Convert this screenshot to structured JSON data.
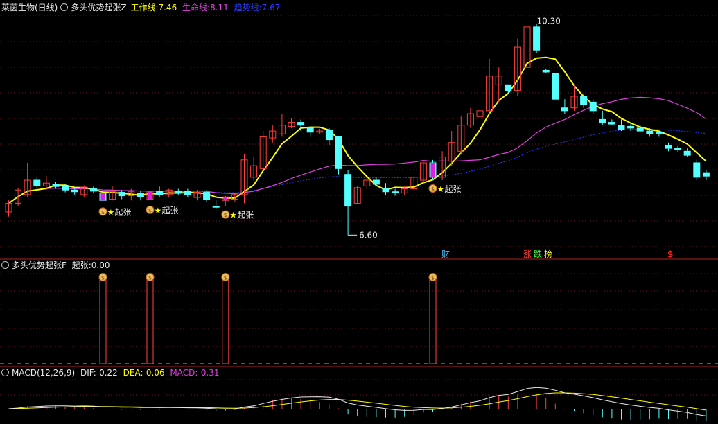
{
  "colors": {
    "background": "#000000",
    "up": "#ff4040",
    "down": "#54ffff",
    "work_line": "#ffff00",
    "life_line": "#e040e0",
    "trend_line": "#2a3cff",
    "grid": "#7a1010",
    "signal": "#ffff00",
    "white": "#e8e8e8"
  },
  "header_main": {
    "stock": "莱茵生物(日线)",
    "indicator": "多头优势起张Z",
    "work_label": "工作线:",
    "work_value": "7.46",
    "life_label": "生命线:",
    "life_value": "8.11",
    "trend_label": "趋势线:",
    "trend_value": "7.67"
  },
  "header_sub": {
    "indicator": "多头优势起张F",
    "signal_label": "起张:",
    "signal_value": "0.00"
  },
  "header_macd": {
    "indicator": "MACD(12,26,9)",
    "dif_label": "DIF:",
    "dif_value": "-0.22",
    "dea_label": "DEA:",
    "dea_value": "-0.06",
    "macd_label": "MACD:",
    "macd_value": "-0.31"
  },
  "annotations": {
    "high_label": "10.30",
    "low_label": "6.60",
    "signal_text": "起张",
    "signal_icon": "money-bag-icon",
    "event_cai": "财",
    "event_zhang": "涨",
    "event_die": "跌",
    "event_bang": "榜",
    "event_s": "$"
  },
  "chart_data": [
    {
      "type": "candlestick",
      "name": "main",
      "y_range": [
        6.4,
        10.45
      ],
      "candles": [
        [
          7.0,
          7.15,
          6.92,
          7.2
        ],
        [
          7.15,
          7.38,
          7.1,
          7.42
        ],
        [
          7.3,
          7.55,
          7.25,
          7.85
        ],
        [
          7.55,
          7.45,
          7.4,
          7.6
        ],
        [
          7.45,
          7.5,
          7.38,
          7.62
        ],
        [
          7.48,
          7.44,
          7.4,
          7.52
        ],
        [
          7.44,
          7.38,
          7.34,
          7.48
        ],
        [
          7.38,
          7.35,
          7.3,
          7.42
        ],
        [
          7.3,
          7.43,
          7.25,
          7.46
        ],
        [
          7.4,
          7.36,
          7.32,
          7.44
        ],
        [
          7.33,
          7.2,
          7.15,
          7.4
        ],
        [
          7.22,
          7.35,
          7.2,
          7.44
        ],
        [
          7.34,
          7.28,
          7.22,
          7.38
        ],
        [
          7.28,
          7.35,
          7.2,
          7.4
        ],
        [
          7.32,
          7.26,
          7.2,
          7.36
        ],
        [
          7.22,
          7.36,
          7.18,
          7.4
        ],
        [
          7.36,
          7.3,
          7.25,
          7.44
        ],
        [
          7.3,
          7.38,
          7.25,
          7.4
        ],
        [
          7.36,
          7.34,
          7.3,
          7.4
        ],
        [
          7.36,
          7.3,
          7.25,
          7.4
        ],
        [
          7.25,
          7.34,
          7.2,
          7.38
        ],
        [
          7.34,
          7.22,
          7.18,
          7.38
        ],
        [
          7.1,
          7.08,
          7.05,
          7.2
        ],
        [
          7.2,
          7.26,
          7.1,
          7.28
        ],
        [
          7.22,
          7.3,
          7.18,
          7.32
        ],
        [
          7.3,
          7.9,
          7.15,
          8.0
        ],
        [
          7.6,
          7.8,
          7.55,
          7.95
        ],
        [
          7.75,
          8.3,
          7.7,
          8.4
        ],
        [
          8.28,
          8.4,
          8.2,
          8.5
        ],
        [
          8.35,
          8.5,
          8.3,
          8.7
        ],
        [
          8.48,
          8.55,
          8.45,
          8.62
        ],
        [
          8.55,
          8.5,
          8.4,
          8.6
        ],
        [
          8.45,
          8.38,
          8.3,
          8.45
        ],
        [
          8.38,
          8.4,
          8.35,
          8.44
        ],
        [
          8.42,
          8.25,
          8.15,
          8.45
        ],
        [
          8.3,
          7.75,
          7.65,
          8.3
        ],
        [
          7.65,
          7.1,
          6.6,
          7.72
        ],
        [
          7.15,
          7.42,
          7.15,
          7.45
        ],
        [
          7.45,
          7.55,
          7.4,
          7.6
        ],
        [
          7.55,
          7.48,
          7.45,
          7.6
        ],
        [
          7.4,
          7.35,
          7.3,
          7.5
        ],
        [
          7.35,
          7.33,
          7.28,
          7.4
        ],
        [
          7.33,
          7.4,
          7.3,
          7.45
        ],
        [
          7.4,
          7.6,
          7.38,
          7.62
        ],
        [
          7.55,
          7.85,
          7.5,
          7.85
        ],
        [
          7.85,
          7.6,
          7.55,
          7.9
        ],
        [
          7.6,
          7.95,
          7.55,
          8.05
        ],
        [
          7.88,
          8.2,
          7.8,
          8.4
        ],
        [
          8.05,
          8.5,
          8.0,
          8.65
        ],
        [
          8.5,
          8.7,
          8.45,
          8.8
        ],
        [
          8.65,
          8.75,
          8.6,
          8.85
        ],
        [
          8.75,
          9.35,
          8.7,
          9.65
        ],
        [
          9.2,
          9.35,
          8.9,
          9.5
        ],
        [
          9.2,
          9.1,
          9.05,
          9.2
        ],
        [
          9.1,
          9.85,
          9.0,
          10.0
        ],
        [
          9.5,
          10.2,
          9.3,
          10.3
        ],
        [
          10.2,
          9.8,
          9.75,
          10.25
        ],
        [
          9.45,
          9.42,
          9.4,
          9.48
        ],
        [
          9.4,
          8.95,
          8.95,
          9.35
        ],
        [
          8.8,
          8.75,
          8.7,
          8.95
        ],
        [
          8.8,
          9.0,
          8.75,
          9.2
        ],
        [
          9.0,
          8.85,
          8.8,
          9.05
        ],
        [
          8.9,
          8.75,
          8.7,
          8.95
        ],
        [
          8.6,
          8.55,
          8.5,
          8.75
        ],
        [
          8.55,
          8.52,
          8.5,
          8.6
        ],
        [
          8.5,
          8.42,
          8.4,
          8.6
        ],
        [
          8.48,
          8.45,
          8.4,
          8.55
        ],
        [
          8.45,
          8.4,
          8.38,
          8.5
        ],
        [
          8.4,
          8.35,
          8.3,
          8.45
        ],
        [
          8.38,
          8.36,
          8.3,
          8.4
        ],
        [
          8.15,
          8.1,
          8.05,
          8.2
        ],
        [
          8.1,
          8.08,
          8.04,
          8.14
        ],
        [
          8.05,
          7.98,
          7.95,
          8.1
        ],
        [
          7.85,
          7.6,
          7.55,
          7.9
        ],
        [
          7.68,
          7.62,
          7.55,
          7.72
        ]
      ],
      "high": 10.3,
      "low": 6.6,
      "signal_indices": [
        10,
        15,
        23,
        45
      ]
    },
    {
      "type": "line",
      "name": "sub",
      "y_range": [
        0,
        1.2
      ],
      "signal_indices": [
        10,
        15,
        23,
        45
      ],
      "values_note_value": 1
    },
    {
      "type": "bar",
      "name": "macd",
      "y_range": [
        -0.55,
        0.55
      ]
    }
  ]
}
